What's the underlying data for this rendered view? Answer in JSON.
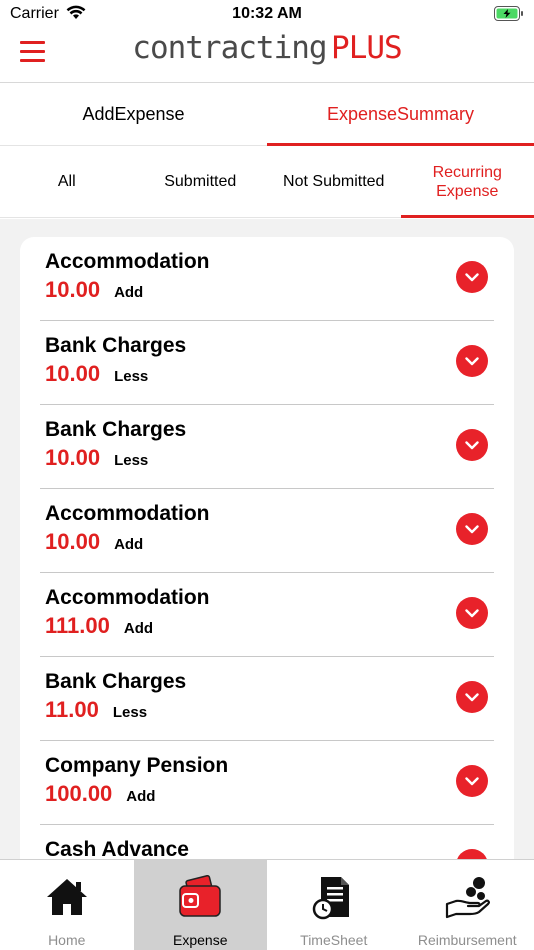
{
  "status_bar": {
    "carrier": "Carrier",
    "time": "10:32 AM"
  },
  "header": {
    "logo_main": "contracting",
    "logo_plus": "PLUS"
  },
  "main_tabs": [
    {
      "label": "AddExpense",
      "active": false
    },
    {
      "label": "ExpenseSummary",
      "active": true
    }
  ],
  "sub_tabs": [
    {
      "label": "All",
      "active": false
    },
    {
      "label": "Submitted",
      "active": false
    },
    {
      "label": "Not Submitted",
      "active": false
    },
    {
      "label": "Recurring Expense",
      "active": true
    }
  ],
  "expenses": [
    {
      "name": "Accommodation",
      "amount": "10.00",
      "type": "Add"
    },
    {
      "name": "Bank Charges",
      "amount": "10.00",
      "type": "Less"
    },
    {
      "name": "Bank Charges",
      "amount": "10.00",
      "type": "Less"
    },
    {
      "name": "Accommodation",
      "amount": "10.00",
      "type": "Add"
    },
    {
      "name": "Accommodation",
      "amount": "111.00",
      "type": "Add"
    },
    {
      "name": "Bank Charges",
      "amount": "11.00",
      "type": "Less"
    },
    {
      "name": "Company Pension",
      "amount": "100.00",
      "type": "Add"
    },
    {
      "name": "Cash Advance",
      "amount": "",
      "type": ""
    }
  ],
  "bottom_tabs": [
    {
      "label": "Home",
      "icon": "home-icon",
      "active": false
    },
    {
      "label": "Expense",
      "icon": "wallet-icon",
      "active": true
    },
    {
      "label": "TimeSheet",
      "icon": "timesheet-icon",
      "active": false
    },
    {
      "label": "Reimbursement",
      "icon": "reimbursement-icon",
      "active": false
    }
  ],
  "colors": {
    "accent": "#e02020",
    "text": "#000000",
    "muted": "#8e8e8e",
    "background": "#f2f2f2"
  }
}
